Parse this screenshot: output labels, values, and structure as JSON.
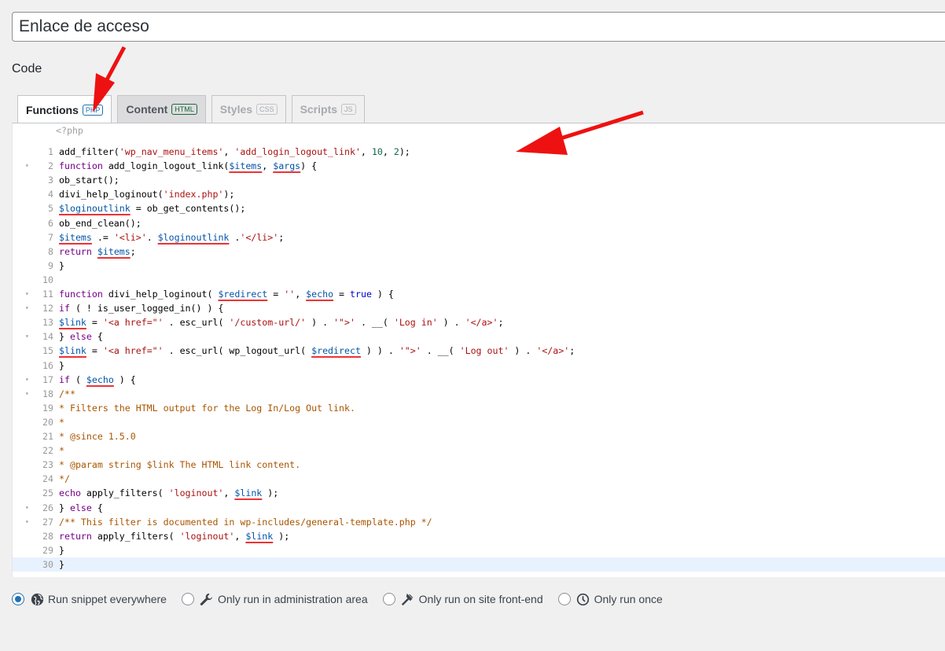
{
  "snippet": {
    "title_value": "Enlace de acceso"
  },
  "section": {
    "code_label": "Code"
  },
  "tabs": [
    {
      "label": "Functions",
      "badge": "PHP"
    },
    {
      "label": "Content",
      "badge": "HTML"
    },
    {
      "label": "Styles",
      "badge": "CSS"
    },
    {
      "label": "Scripts",
      "badge": "JS"
    }
  ],
  "editor": {
    "php_open_tag": "<?php",
    "line_numbers": [
      "1",
      "2",
      "3",
      "4",
      "5",
      "6",
      "7",
      "8",
      "9",
      "10",
      "11",
      "12",
      "13",
      "14",
      "15",
      "16",
      "17",
      "18",
      "19",
      "20",
      "21",
      "22",
      "23",
      "24",
      "25",
      "26",
      "27",
      "28",
      "29",
      "30"
    ],
    "lines": [
      "add_filter('wp_nav_menu_items', 'add_login_logout_link', 10, 2);",
      "function add_login_logout_link($items, $args) {",
      "ob_start();",
      "divi_help_loginout('index.php');",
      "$loginoutlink = ob_get_contents();",
      "ob_end_clean();",
      "$items .= '<li>'. $loginoutlink .'</li>';",
      "return $items;",
      "}",
      "",
      "function divi_help_loginout( $redirect = '', $echo = true ) {",
      "if ( ! is_user_logged_in() ) {",
      "$link = '<a href=\"' . esc_url( '/custom-url/' ) . '\">' . __( 'Log in' ) . '</a>';",
      "} else {",
      "$link = '<a href=\"' . esc_url( wp_logout_url( $redirect ) ) . '\">' . __( 'Log out' ) . '</a>';",
      "}",
      "if ( $echo ) {",
      "/**",
      "* Filters the HTML output for the Log In/Log Out link.",
      "*",
      "* @since 1.5.0",
      "*",
      "* @param string $link The HTML link content.",
      "*/",
      "echo apply_filters( 'loginout', $link );",
      "} else {",
      "/** This filter is documented in wp-includes/general-template.php */",
      "return apply_filters( 'loginout', $link );",
      "}",
      "}"
    ]
  },
  "scope": {
    "options": [
      {
        "label": "Run snippet everywhere",
        "icon": "globe-icon",
        "checked": true
      },
      {
        "label": "Only run in administration area",
        "icon": "wrench-icon",
        "checked": false
      },
      {
        "label": "Only run on site front-end",
        "icon": "hammer-icon",
        "checked": false
      },
      {
        "label": "Only run once",
        "icon": "clock-icon",
        "checked": false
      }
    ]
  },
  "colors": {
    "accent": "#2271b1",
    "annotation_arrow": "#ee1111",
    "keyword": "#770088",
    "variable": "#0055aa",
    "string": "#aa1111",
    "comment": "#aa5500"
  }
}
